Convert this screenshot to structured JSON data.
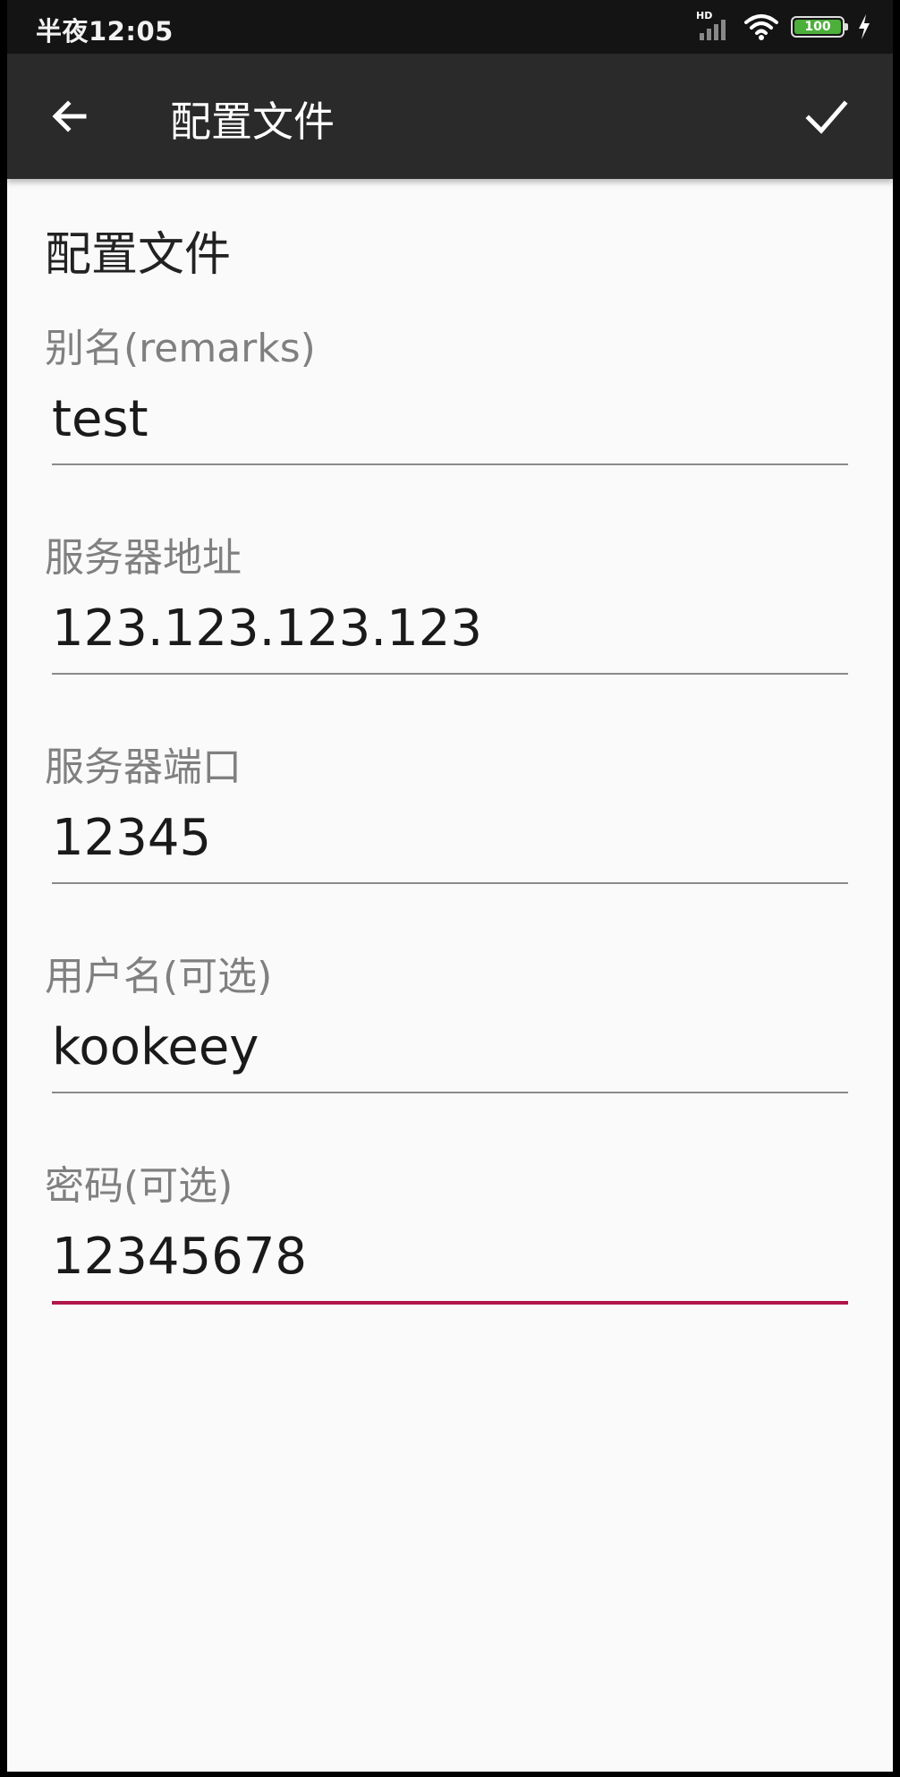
{
  "status_bar": {
    "time": "半夜12:05",
    "hd": "HD",
    "battery": "100"
  },
  "app_bar": {
    "title": "配置文件",
    "back_icon": "arrow-back-icon",
    "confirm_icon": "check-icon"
  },
  "form": {
    "section_title": "配置文件",
    "fields": [
      {
        "label": "别名(remarks)",
        "value": "test"
      },
      {
        "label": "服务器地址",
        "value": "123.123.123.123"
      },
      {
        "label": "服务器端口",
        "value": "12345"
      },
      {
        "label": "用户名(可选)",
        "value": "kookeey"
      },
      {
        "label": "密码(可选)",
        "value": "12345678"
      }
    ]
  },
  "colors": {
    "accent": "#b0164a",
    "app_bar": "#2a2a2a",
    "status_bar": "#141414",
    "background": "#fafafa",
    "battery": "#4caf3a"
  }
}
